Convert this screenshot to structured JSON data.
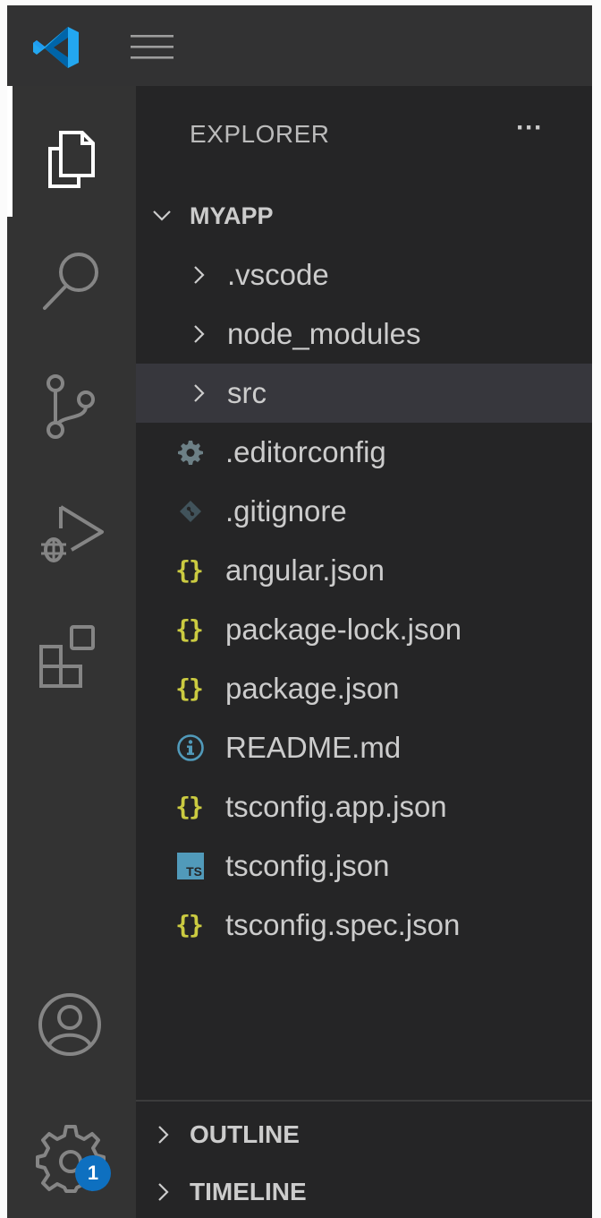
{
  "app": {
    "logo": "vscode-logo-icon",
    "menu_icon": "hamburger-menu-icon"
  },
  "activity_bar": {
    "items": [
      {
        "name": "explorer",
        "icon": "files-icon",
        "active": true
      },
      {
        "name": "search",
        "icon": "search-icon"
      },
      {
        "name": "source-control",
        "icon": "source-control-icon"
      },
      {
        "name": "run-and-debug",
        "icon": "run-debug-icon"
      },
      {
        "name": "extensions",
        "icon": "extensions-icon"
      }
    ],
    "account_icon": "account-icon",
    "settings_icon": "gear-icon",
    "settings_badge": "1",
    "colors": {
      "badge": "#0e70c0",
      "active_bar": "#ffffff"
    }
  },
  "explorer": {
    "title": "EXPLORER",
    "more_actions": "···",
    "root": {
      "label": "MYAPP",
      "expanded": true
    },
    "items": [
      {
        "label": ".vscode",
        "type": "folder",
        "expanded": false
      },
      {
        "label": "node_modules",
        "type": "folder",
        "expanded": false
      },
      {
        "label": "src",
        "type": "folder",
        "expanded": false,
        "selected": true
      },
      {
        "label": ".editorconfig",
        "type": "file",
        "icon": "gear-icon"
      },
      {
        "label": ".gitignore",
        "type": "file",
        "icon": "git-icon"
      },
      {
        "label": "angular.json",
        "type": "file",
        "icon": "json-icon"
      },
      {
        "label": "package-lock.json",
        "type": "file",
        "icon": "json-icon"
      },
      {
        "label": "package.json",
        "type": "file",
        "icon": "json-icon"
      },
      {
        "label": "README.md",
        "type": "file",
        "icon": "info-icon"
      },
      {
        "label": "tsconfig.app.json",
        "type": "file",
        "icon": "json-icon"
      },
      {
        "label": "tsconfig.json",
        "type": "file",
        "icon": "typescript-icon"
      },
      {
        "label": "tsconfig.spec.json",
        "type": "file",
        "icon": "json-icon"
      }
    ],
    "json_glyph": "{}",
    "ts_glyph": "TS"
  },
  "panels": [
    {
      "label": "OUTLINE",
      "expanded": false
    },
    {
      "label": "TIMELINE",
      "expanded": false
    }
  ],
  "colors": {
    "json_icon": "#cbcb41",
    "info_icon": "#519aba",
    "ts_icon": "#519aba",
    "config_icon": "#6d8086",
    "selected_row": "#37373d"
  }
}
